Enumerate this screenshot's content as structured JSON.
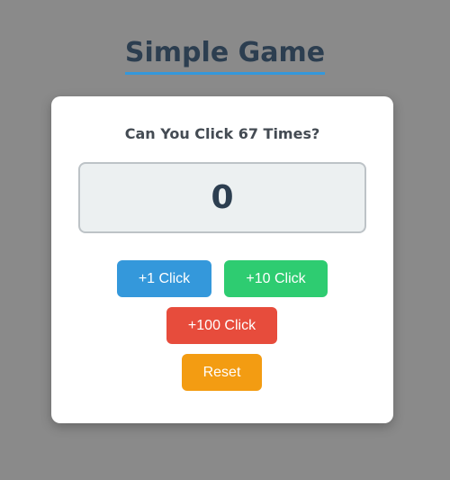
{
  "page": {
    "title": "Simple Game",
    "background": "#8a8a8a"
  },
  "card": {
    "question": "Can You Click 67 Times?",
    "counter_value": "0"
  },
  "buttons": {
    "plus_one": {
      "label": "+1 Click",
      "color": "#3498db"
    },
    "plus_ten": {
      "label": "+10 Click",
      "color": "#2ecc71"
    },
    "plus_hundred": {
      "label": "+100 Click",
      "color": "#e74c3c"
    },
    "reset": {
      "label": "Reset",
      "color": "#f39c12"
    }
  },
  "colors": {
    "title": "#2c3e50",
    "title_underline": "#3498db",
    "counter_bg": "#ecf0f1",
    "counter_border": "#bdc3c7"
  }
}
